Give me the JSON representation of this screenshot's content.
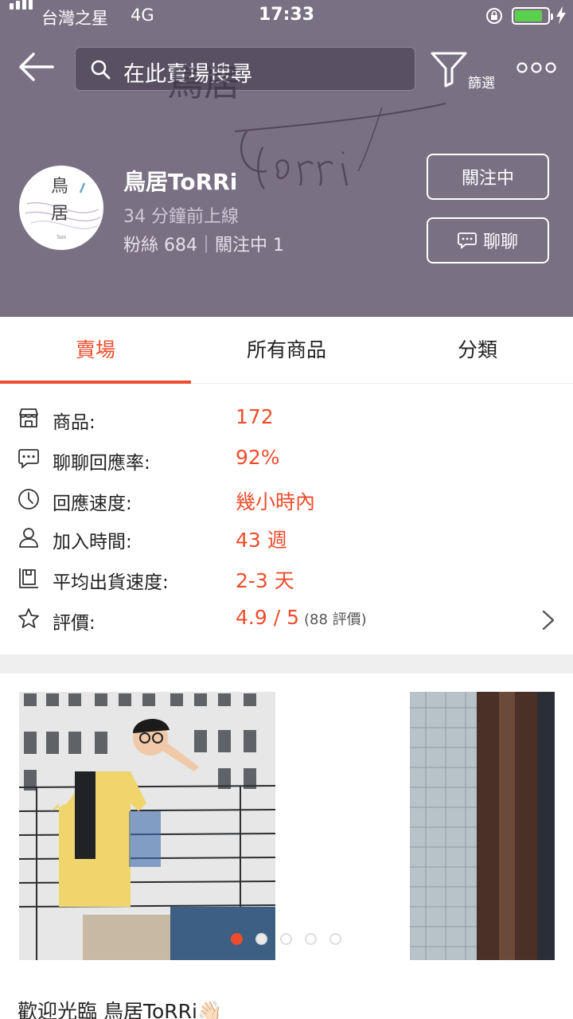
{
  "status_bar": {
    "carrier": "台灣之星",
    "network": "4G",
    "time": "17:33",
    "battery_level": 0.85
  },
  "search": {
    "placeholder": "在此賣場搜尋"
  },
  "filter": {
    "label": "篩選"
  },
  "shop": {
    "name": "鳥居ToRRi",
    "online_status": "34 分鐘前上線",
    "followers_label": "粉絲",
    "followers": "684",
    "following_label": "關注中",
    "following": "1",
    "stats_text": "粉絲 684｜關注中 1",
    "follow_button": "關注中",
    "chat_button": "聊聊",
    "avatar_text": "鳥居",
    "watermark_text": "Torri 鳥居"
  },
  "tabs": [
    {
      "label": "賣場",
      "active": true
    },
    {
      "label": "所有商品",
      "active": false
    },
    {
      "label": "分類",
      "active": false
    }
  ],
  "info": [
    {
      "icon": "shop-icon",
      "label": "商品:",
      "value": "172"
    },
    {
      "icon": "chat-bubble-icon",
      "label": "聊聊回應率:",
      "value": "92%"
    },
    {
      "icon": "clock-icon",
      "label": "回應速度:",
      "value": "幾小時內"
    },
    {
      "icon": "user-icon",
      "label": "加入時間:",
      "value": "43 週"
    },
    {
      "icon": "shipping-icon",
      "label": "平均出貨速度:",
      "value": "2-3 天"
    },
    {
      "icon": "star-icon",
      "label": "評價:",
      "value": "4.9 / 5",
      "sub": "(88 評價)"
    }
  ],
  "gallery": {
    "page_count": 5,
    "active_index": 0
  },
  "welcome_text": "歡迎光臨 鳥居ToRRi👋🏻",
  "colors": {
    "header_bg": "#7a7083",
    "accent": "#ee4d2d"
  }
}
